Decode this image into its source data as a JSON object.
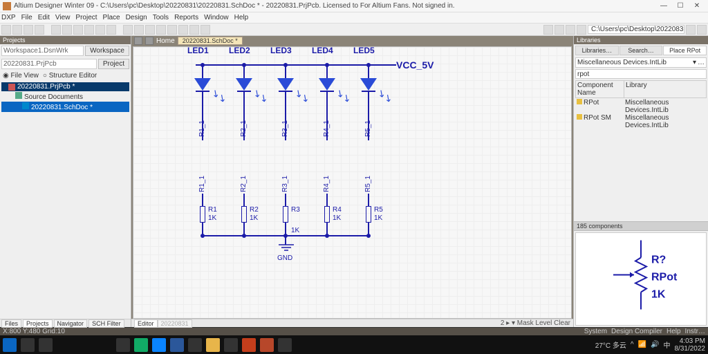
{
  "title": "Altium Designer Winter 09 - C:\\Users\\pc\\Desktop\\20220831\\20220831.SchDoc * - 20220831.PrjPcb. Licensed to For Altium Fans. Not signed in.",
  "menu": [
    "DXP",
    "File",
    "Edit",
    "View",
    "Project",
    "Place",
    "Design",
    "Tools",
    "Reports",
    "Window",
    "Help"
  ],
  "path_box": "C:\\Users\\pc\\Desktop\\20220831 ▾",
  "projects": {
    "title": "Projects",
    "workspace": "Workspace1.DsnWrk",
    "workspace_btn": "Workspace",
    "project": "20220831.PrjPcb",
    "project_btn": "Project",
    "radio1": "File View",
    "radio2": "Structure Editor",
    "tree": {
      "root": "20220831.PrjPcb *",
      "src": "Source Documents",
      "doc": "20220831.SchDoc *"
    }
  },
  "doctab": "20220831.SchDoc *",
  "home": "Home",
  "schem": {
    "labels": [
      "LED1",
      "LED2",
      "LED3",
      "LED4",
      "LED5"
    ],
    "vcc": "VCC_5V",
    "top_res": [
      "R1_1",
      "R2_1",
      "R3_1",
      "R4_1",
      "R5_1"
    ],
    "net": [
      "R1_1",
      "R2_1",
      "R3_1",
      "R4_1",
      "R5_1"
    ],
    "res": [
      {
        "d": "R1",
        "v": "1K"
      },
      {
        "d": "R2",
        "v": "1K"
      },
      {
        "d": "R3",
        "v": "1K"
      },
      {
        "d": "R4",
        "v": "1K"
      },
      {
        "d": "R5",
        "v": "1K"
      }
    ],
    "gnd": "GND"
  },
  "editor_tab": "Editor",
  "editor_doc": "20220831",
  "status_right": "2 ▸ ▾ Mask Level Clear",
  "foot_tabs": [
    "Files",
    "Projects",
    "Navigator",
    "SCH Filter"
  ],
  "coord": "X:800 Y:480   Grid:10",
  "libs": {
    "title": "Libraries",
    "tabs": [
      "Libraries…",
      "Search…",
      "Place RPot"
    ],
    "libname": "Miscellaneous Devices.IntLib",
    "search": "rpot",
    "head1": "Component Name",
    "head2": "Library",
    "rows": [
      {
        "n": "RPot",
        "l": "Miscellaneous Devices.IntLib"
      },
      {
        "n": "RPot SM",
        "l": "Miscellaneous Devices.IntLib"
      }
    ],
    "count": "185 components",
    "preview": {
      "d": "R?",
      "n": "RPot",
      "v": "1K"
    }
  },
  "sysfoot": [
    "System",
    "Design Compiler",
    "Help",
    "Instr…"
  ],
  "tray": {
    "weather": "27°C 多云",
    "time": "4:03 PM",
    "date": "8/31/2022"
  }
}
